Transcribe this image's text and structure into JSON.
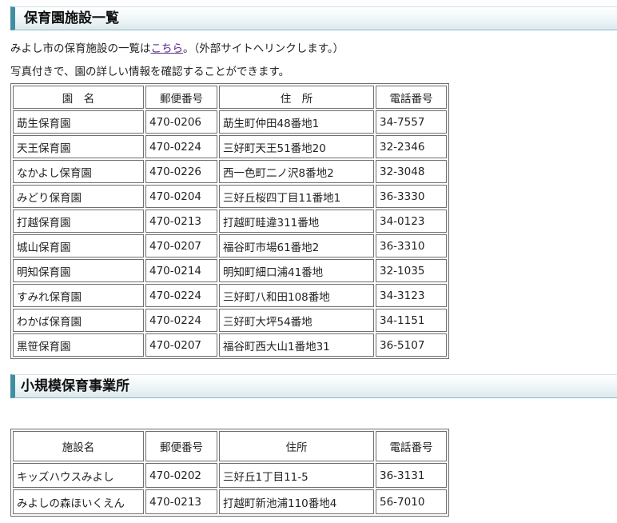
{
  "section1": {
    "heading": "保育園施設一覧",
    "intro_before_link": "みよし市の保育施設の一覧は",
    "intro_link": "こちら",
    "intro_after_link": "。（外部サイトへリンクします。）",
    "intro_line2": "写真付きで、園の詳しい情報を確認することができます。",
    "headers": [
      "園　名",
      "郵便番号",
      "住　所",
      "電話番号"
    ],
    "rows": [
      [
        "莇生保育園",
        "470-0206",
        "莇生町仲田48番地1",
        "34-7557"
      ],
      [
        "天王保育園",
        "470-0224",
        "三好町天王51番地20",
        "32-2346"
      ],
      [
        "なかよし保育園",
        "470-0226",
        "西一色町二ノ沢8番地2",
        "32-3048"
      ],
      [
        "みどり保育園",
        "470-0204",
        "三好丘桜四丁目11番地1",
        "36-3330"
      ],
      [
        "打越保育園",
        "470-0213",
        "打越町畦違311番地",
        "34-0123"
      ],
      [
        "城山保育園",
        "470-0207",
        "福谷町市場61番地2",
        "36-3310"
      ],
      [
        "明知保育園",
        "470-0214",
        "明知町細口浦41番地",
        "32-1035"
      ],
      [
        "すみれ保育園",
        "470-0224",
        "三好町八和田108番地",
        "34-3123"
      ],
      [
        "わかば保育園",
        "470-0224",
        "三好町大坪54番地",
        "34-1151"
      ],
      [
        "黒笹保育園",
        "470-0207",
        "福谷町西大山1番地31",
        "36-5107"
      ]
    ]
  },
  "section2": {
    "heading": "小規模保育事業所",
    "headers": [
      "施設名",
      "郵便番号",
      "住所",
      "電話番号"
    ],
    "rows": [
      [
        "キッズハウスみよし",
        "470-0202",
        "三好丘1丁目11-5",
        "36-3131"
      ],
      [
        "みよしの森ほいくえん",
        "470-0213",
        "打越町新池浦110番地4",
        "56-7010"
      ]
    ]
  }
}
